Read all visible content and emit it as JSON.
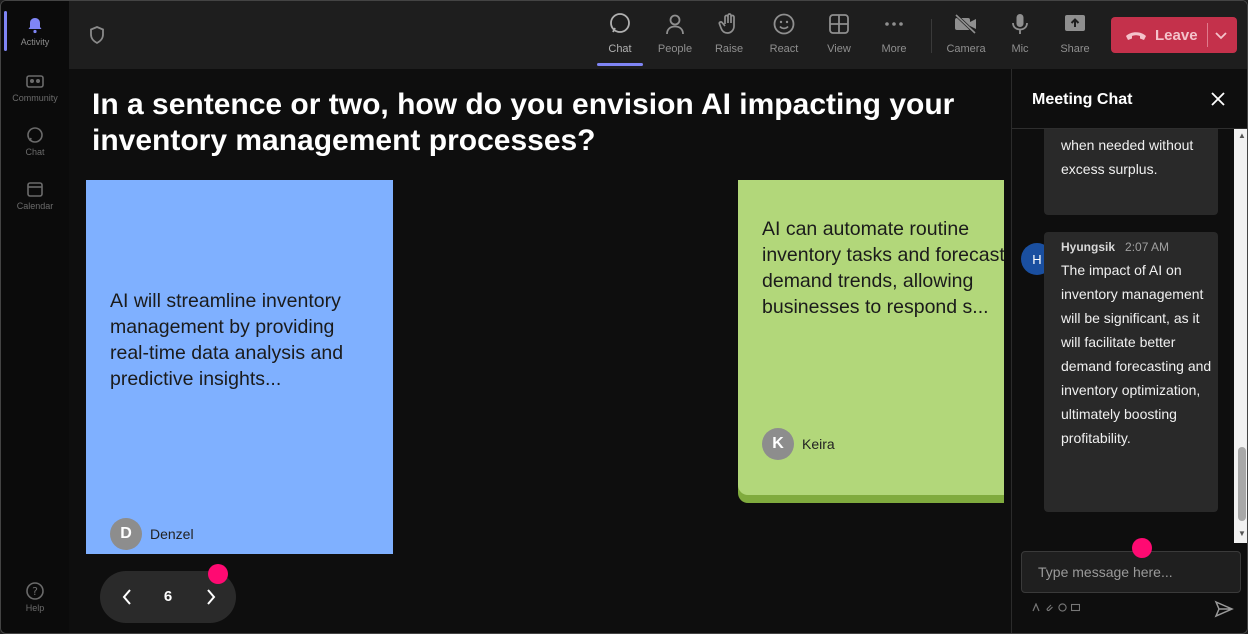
{
  "rail": {
    "items": [
      {
        "label": "Activity",
        "icon": "bell-icon"
      },
      {
        "label": "Community",
        "icon": "community-icon"
      },
      {
        "label": "Chat",
        "icon": "chat-icon"
      },
      {
        "label": "Calendar",
        "icon": "calendar-icon"
      }
    ],
    "help": {
      "label": "Help",
      "icon": "help-icon"
    }
  },
  "toolbar": {
    "buttons": [
      {
        "label": "Chat",
        "icon": "chat-icon"
      },
      {
        "label": "People",
        "icon": "people-icon"
      },
      {
        "label": "Raise",
        "icon": "raise-hand-icon"
      },
      {
        "label": "React",
        "icon": "smiley-icon"
      },
      {
        "label": "View",
        "icon": "grid-icon"
      },
      {
        "label": "More",
        "icon": "more-icon"
      },
      {
        "label": "Camera",
        "icon": "camera-off-icon"
      },
      {
        "label": "Mic",
        "icon": "mic-icon"
      },
      {
        "label": "Share",
        "icon": "share-icon"
      }
    ],
    "leave_label": "Leave",
    "accent": "#7f85f5",
    "leave_color": "#c4314b"
  },
  "main": {
    "question": "In a sentence or two, how do you envision AI impacting your inventory management processes?",
    "cards": [
      {
        "text": "AI will streamline inventory management by providing real-time data analysis and predictive insights...",
        "author": "Denzel",
        "initial": "D",
        "color": "#7fb0ff"
      },
      {
        "text": "AI can automate routine inventory tasks and forecast demand trends, allowing businesses to respond s...",
        "author": "Keira",
        "initial": "K",
        "color": "#b2d77a"
      }
    ],
    "pager": {
      "page": "6"
    },
    "marker_color": "#ff0a72"
  },
  "chat": {
    "title": "Meeting Chat",
    "messages": [
      {
        "text": "when needed without excess surplus."
      },
      {
        "sender": "Hyungsik",
        "initial": "H",
        "time": "2:07 AM",
        "text": "The impact of AI on inventory management will be significant, as it will facilitate better demand forecasting and inventory optimization, ultimately boosting profitability."
      }
    ],
    "input_placeholder": "Type message here..."
  }
}
